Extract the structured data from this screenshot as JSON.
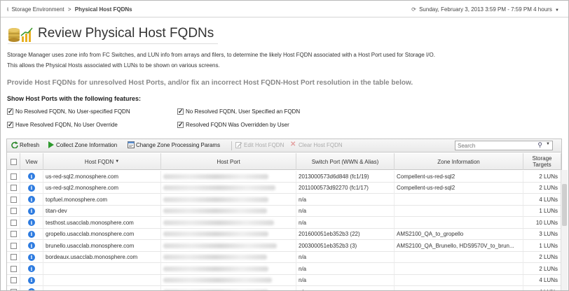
{
  "breadcrumb": {
    "parent": "Storage Environment",
    "separator": ">",
    "current": "Physical Host FQDNs"
  },
  "time_range": "Sunday, February 3, 2013 3:59 PM - 7:59 PM 4 hours",
  "page_title": "Review Physical Host FQDNs",
  "description": [
    "Storage Manager uses zone info from FC Switches, and LUN info from arrays and filers, to determine the likely Host FQDN associated with a Host Port used for Storage I/O.",
    "This allows the Physical Hosts associated with LUNs to be shown on various screens."
  ],
  "prompt": "Provide Host FQDNs for unresolved Host Ports, and/or fix an incorrect Host FQDN-Host Port resolution in the table below.",
  "filters": {
    "title": "Show Host Ports with the following features:",
    "options": [
      {
        "label": "No Resolved FQDN, No User-specified FQDN",
        "checked": true
      },
      {
        "label": "No Resolved FQDN, User Specified an FQDN",
        "checked": true
      },
      {
        "label": "Have Resolved FQDN, No User Override",
        "checked": true
      },
      {
        "label": "Resolved FQDN Was Overridden by User",
        "checked": true
      }
    ]
  },
  "toolbar": {
    "refresh": "Refresh",
    "collect": "Collect Zone Information",
    "change": "Change Zone Processing Params",
    "edit": "Edit Host FQDN",
    "clear": "Clear Host FQDN",
    "search_placeholder": "Search"
  },
  "columns": {
    "view": "View",
    "fqdn": "Host FQDN",
    "port": "Host Port",
    "switch": "Switch Port (WWN & Alias)",
    "zone": "Zone Information",
    "targets_line1": "Storage",
    "targets_line2": "Targets"
  },
  "rows": [
    {
      "fqdn": "us-red-sql2.monosphere.com",
      "switch": "2013000573d6d848 (fc1/19)",
      "zone": "Compellent-us-red-sql2",
      "targets": "2 LUNs"
    },
    {
      "fqdn": "us-red-sql2.monosphere.com",
      "switch": "2011000573d92270 (fc1/17)",
      "zone": "Compellent-us-red-sql2",
      "targets": "2 LUNs"
    },
    {
      "fqdn": "topfuel.monosphere.com",
      "switch": "n/a",
      "zone": "",
      "targets": "4 LUNs"
    },
    {
      "fqdn": "titan-dev",
      "switch": "n/a",
      "zone": "",
      "targets": "1 LUNs"
    },
    {
      "fqdn": "testhost.usacclab.monosphere.com",
      "switch": "n/a",
      "zone": "",
      "targets": "10 LUNs"
    },
    {
      "fqdn": "gropello.usacclab.monosphere.com",
      "switch": "201600051eb352b3 (22)",
      "zone": "AMS2100_QA_to_gropello",
      "targets": "3 LUNs"
    },
    {
      "fqdn": "brunello.usacclab.monosphere.com",
      "switch": "200300051eb352b3 (3)",
      "zone": "AMS2100_QA_Brunello, HDS9570V_to_brun...",
      "targets": "1 LUNs"
    },
    {
      "fqdn": "bordeaux.usacclab.monosphere.com",
      "switch": "n/a",
      "zone": "",
      "targets": "2 LUNs"
    },
    {
      "fqdn": "",
      "switch": "n/a",
      "zone": "",
      "targets": "2 LUNs"
    },
    {
      "fqdn": "",
      "switch": "n/a",
      "zone": "",
      "targets": "4 LUNs"
    },
    {
      "fqdn": "",
      "switch": "n/a",
      "zone": "",
      "targets": "4 LUNs"
    }
  ],
  "icons": {
    "info": "info-icon",
    "refresh": "refresh-icon",
    "collect": "play-icon",
    "change": "settings-window-icon",
    "edit": "edit-icon",
    "clear": "clear-x-icon",
    "search": "magnifier-icon",
    "title": "database-chart-icon"
  }
}
